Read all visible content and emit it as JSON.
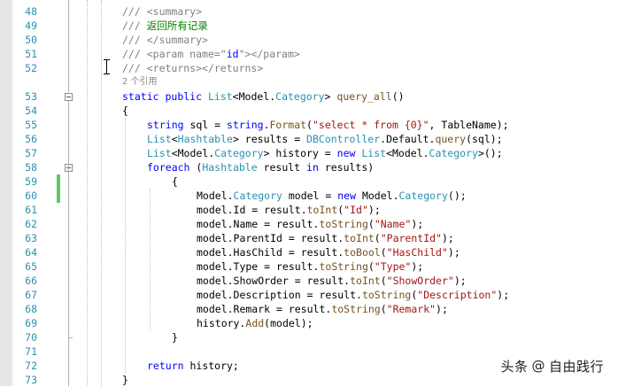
{
  "editor": {
    "code_lens": "2 个引用",
    "lines": [
      {
        "num": "48",
        "fold": "",
        "changed": false,
        "tokens": [
          {
            "t": "///",
            "c": "xd"
          },
          {
            "t": " ",
            "c": ""
          },
          {
            "t": "<summary>",
            "c": "xd"
          }
        ]
      },
      {
        "num": "49",
        "fold": "",
        "changed": false,
        "tokens": [
          {
            "t": "///",
            "c": "xd"
          },
          {
            "t": " 返回所有记录",
            "c": "cm"
          }
        ]
      },
      {
        "num": "50",
        "fold": "",
        "changed": false,
        "tokens": [
          {
            "t": "///",
            "c": "xd"
          },
          {
            "t": " ",
            "c": ""
          },
          {
            "t": "</summary>",
            "c": "xd"
          }
        ]
      },
      {
        "num": "51",
        "fold": "",
        "changed": false,
        "tokens": [
          {
            "t": "///",
            "c": "xd"
          },
          {
            "t": " ",
            "c": ""
          },
          {
            "t": "<param name=\"",
            "c": "xd"
          },
          {
            "t": "id",
            "c": "kw"
          },
          {
            "t": "\"></param>",
            "c": "xd"
          }
        ]
      },
      {
        "num": "52",
        "fold": "",
        "changed": false,
        "tokens": [
          {
            "t": "///",
            "c": "xd"
          },
          {
            "t": " ",
            "c": ""
          },
          {
            "t": "<returns></returns>",
            "c": "xd"
          }
        ]
      },
      {
        "num": "53",
        "fold": "open",
        "changed": false,
        "tokens": [
          {
            "t": "static",
            "c": "kw"
          },
          {
            "t": " ",
            "c": ""
          },
          {
            "t": "public",
            "c": "kw"
          },
          {
            "t": " ",
            "c": ""
          },
          {
            "t": "List",
            "c": "ty"
          },
          {
            "t": "<Model.",
            "c": ""
          },
          {
            "t": "Category",
            "c": "ty"
          },
          {
            "t": "> ",
            "c": ""
          },
          {
            "t": "query_all",
            "c": "fn"
          },
          {
            "t": "()",
            "c": ""
          }
        ]
      },
      {
        "num": "54",
        "fold": "",
        "changed": false,
        "tokens": [
          {
            "t": "{",
            "c": ""
          }
        ]
      },
      {
        "num": "55",
        "fold": "",
        "changed": false,
        "tokens": [
          {
            "t": "string",
            "c": "kw"
          },
          {
            "t": " sql = ",
            "c": ""
          },
          {
            "t": "string",
            "c": "kw"
          },
          {
            "t": ".",
            "c": ""
          },
          {
            "t": "Format",
            "c": "fn"
          },
          {
            "t": "(",
            "c": ""
          },
          {
            "t": "\"select * from {0}\"",
            "c": "st"
          },
          {
            "t": ", TableName);",
            "c": ""
          }
        ]
      },
      {
        "num": "56",
        "fold": "",
        "changed": false,
        "tokens": [
          {
            "t": "List",
            "c": "ty"
          },
          {
            "t": "<",
            "c": ""
          },
          {
            "t": "Hashtable",
            "c": "ty"
          },
          {
            "t": "> results = ",
            "c": ""
          },
          {
            "t": "DBController",
            "c": "ty"
          },
          {
            "t": ".Default.",
            "c": ""
          },
          {
            "t": "query",
            "c": "fn"
          },
          {
            "t": "(sql);",
            "c": ""
          }
        ]
      },
      {
        "num": "57",
        "fold": "",
        "changed": false,
        "tokens": [
          {
            "t": "List",
            "c": "ty"
          },
          {
            "t": "<Model.",
            "c": ""
          },
          {
            "t": "Category",
            "c": "ty"
          },
          {
            "t": "> history = ",
            "c": ""
          },
          {
            "t": "new",
            "c": "kw"
          },
          {
            "t": " ",
            "c": ""
          },
          {
            "t": "List",
            "c": "ty"
          },
          {
            "t": "<Model.",
            "c": ""
          },
          {
            "t": "Category",
            "c": "ty"
          },
          {
            "t": ">();",
            "c": ""
          }
        ]
      },
      {
        "num": "58",
        "fold": "open",
        "changed": false,
        "tokens": [
          {
            "t": "foreach",
            "c": "kw"
          },
          {
            "t": " (",
            "c": ""
          },
          {
            "t": "Hashtable",
            "c": "ty"
          },
          {
            "t": " result ",
            "c": ""
          },
          {
            "t": "in",
            "c": "kw"
          },
          {
            "t": " results)",
            "c": ""
          }
        ]
      },
      {
        "num": "59",
        "fold": "",
        "changed": true,
        "tokens": [
          {
            "t": "{",
            "c": ""
          }
        ]
      },
      {
        "num": "60",
        "fold": "",
        "changed": true,
        "tokens": [
          {
            "t": "Model.",
            "c": ""
          },
          {
            "t": "Category",
            "c": "ty"
          },
          {
            "t": " model = ",
            "c": ""
          },
          {
            "t": "new",
            "c": "kw"
          },
          {
            "t": " Model.",
            "c": ""
          },
          {
            "t": "Category",
            "c": "ty"
          },
          {
            "t": "();",
            "c": ""
          }
        ]
      },
      {
        "num": "61",
        "fold": "",
        "changed": false,
        "tokens": [
          {
            "t": "model.Id = result.",
            "c": ""
          },
          {
            "t": "toInt",
            "c": "fn"
          },
          {
            "t": "(",
            "c": ""
          },
          {
            "t": "\"Id\"",
            "c": "st"
          },
          {
            "t": ");",
            "c": ""
          }
        ]
      },
      {
        "num": "62",
        "fold": "",
        "changed": false,
        "tokens": [
          {
            "t": "model.Name = result.",
            "c": ""
          },
          {
            "t": "toString",
            "c": "fn"
          },
          {
            "t": "(",
            "c": ""
          },
          {
            "t": "\"Name\"",
            "c": "st"
          },
          {
            "t": ");",
            "c": ""
          }
        ]
      },
      {
        "num": "63",
        "fold": "",
        "changed": false,
        "tokens": [
          {
            "t": "model.ParentId = result.",
            "c": ""
          },
          {
            "t": "toInt",
            "c": "fn"
          },
          {
            "t": "(",
            "c": ""
          },
          {
            "t": "\"ParentId\"",
            "c": "st"
          },
          {
            "t": ");",
            "c": ""
          }
        ]
      },
      {
        "num": "64",
        "fold": "",
        "changed": false,
        "tokens": [
          {
            "t": "model.HasChild = result.",
            "c": ""
          },
          {
            "t": "toBool",
            "c": "fn"
          },
          {
            "t": "(",
            "c": ""
          },
          {
            "t": "\"HasChild\"",
            "c": "st"
          },
          {
            "t": ");",
            "c": ""
          }
        ]
      },
      {
        "num": "65",
        "fold": "",
        "changed": false,
        "tokens": [
          {
            "t": "model.Type = result.",
            "c": ""
          },
          {
            "t": "toString",
            "c": "fn"
          },
          {
            "t": "(",
            "c": ""
          },
          {
            "t": "\"Type\"",
            "c": "st"
          },
          {
            "t": ");",
            "c": ""
          }
        ]
      },
      {
        "num": "66",
        "fold": "",
        "changed": false,
        "tokens": [
          {
            "t": "model.ShowOrder = result.",
            "c": ""
          },
          {
            "t": "toInt",
            "c": "fn"
          },
          {
            "t": "(",
            "c": ""
          },
          {
            "t": "\"ShowOrder\"",
            "c": "st"
          },
          {
            "t": ");",
            "c": ""
          }
        ]
      },
      {
        "num": "67",
        "fold": "",
        "changed": false,
        "tokens": [
          {
            "t": "model.Description = result.",
            "c": ""
          },
          {
            "t": "toString",
            "c": "fn"
          },
          {
            "t": "(",
            "c": ""
          },
          {
            "t": "\"Description\"",
            "c": "st"
          },
          {
            "t": ");",
            "c": ""
          }
        ]
      },
      {
        "num": "68",
        "fold": "",
        "changed": false,
        "tokens": [
          {
            "t": "model.Remark = result.",
            "c": ""
          },
          {
            "t": "toString",
            "c": "fn"
          },
          {
            "t": "(",
            "c": ""
          },
          {
            "t": "\"Remark\"",
            "c": "st"
          },
          {
            "t": ");",
            "c": ""
          }
        ]
      },
      {
        "num": "69",
        "fold": "",
        "changed": false,
        "tokens": [
          {
            "t": "history.",
            "c": ""
          },
          {
            "t": "Add",
            "c": "fn"
          },
          {
            "t": "(model);",
            "c": ""
          }
        ]
      },
      {
        "num": "70",
        "fold": "",
        "changed": false,
        "tokens": [
          {
            "t": "}",
            "c": ""
          }
        ]
      },
      {
        "num": "71",
        "fold": "",
        "changed": false,
        "tokens": []
      },
      {
        "num": "72",
        "fold": "",
        "changed": false,
        "tokens": [
          {
            "t": "return",
            "c": "kw"
          },
          {
            "t": " history;",
            "c": ""
          }
        ]
      },
      {
        "num": "73",
        "fold": "",
        "changed": false,
        "tokens": [
          {
            "t": "}",
            "c": ""
          }
        ]
      }
    ]
  },
  "watermark": {
    "brand": "头条",
    "at": "@",
    "author": "自由践行"
  },
  "colors": {
    "keyword": "#0000ff",
    "type": "#2b91af",
    "string": "#a31515",
    "comment": "#008000",
    "xml_doc": "#808080",
    "method": "#74531f",
    "line_number": "#2b91af",
    "change_marker": "#5fc85f"
  },
  "icons": {
    "fold_toggle": "collapse-minus-icon",
    "cursor": "i-beam-cursor-icon"
  }
}
